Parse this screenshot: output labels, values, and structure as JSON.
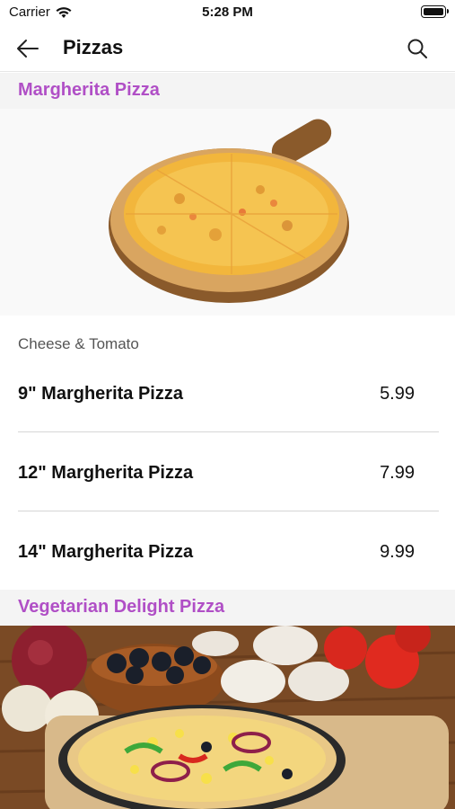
{
  "status_bar": {
    "carrier": "Carrier",
    "time": "5:28 PM"
  },
  "nav": {
    "title": "Pizzas",
    "back_icon": "arrow-left-icon",
    "search_icon": "search-icon"
  },
  "sections": [
    {
      "title": "Margherita Pizza",
      "subtitle": "Cheese & Tomato",
      "items": [
        {
          "name": "9\" Margherita Pizza",
          "price": "5.99"
        },
        {
          "name": "12\" Margherita Pizza",
          "price": "7.99"
        },
        {
          "name": "14\" Margherita Pizza",
          "price": "9.99"
        }
      ]
    },
    {
      "title": "Vegetarian Delight Pizza"
    }
  ],
  "colors": {
    "accent": "#b04fc6",
    "section_bg": "#f4f4f4",
    "divider": "#d6d6d6"
  }
}
